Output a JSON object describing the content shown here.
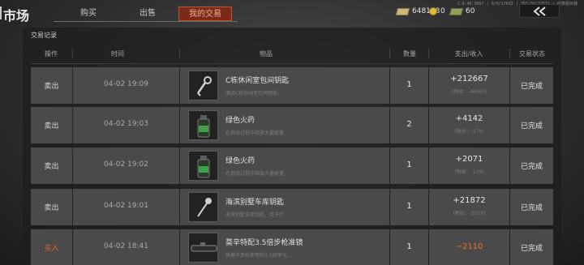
{
  "header": {
    "title": "市场",
    "tabs": [
      {
        "label": "购买",
        "active": false
      },
      {
        "label": "出售",
        "active": false
      },
      {
        "label": "我的交易",
        "active": true
      }
    ],
    "corner_text": "1.0.46.9057 | 0/0/27632 | 355/38/33572 | 结算服务器",
    "currencies": [
      {
        "icon": "cash-icon",
        "value": "648138"
      },
      {
        "icon": "coin-icon",
        "value": "0"
      },
      {
        "icon": "bill-icon",
        "value": "60"
      }
    ],
    "back_icon": "double-chevron-left-icon"
  },
  "section_title": "交易记录",
  "columns": {
    "op": "操作",
    "time": "时间",
    "item": "物品",
    "qty": "数量",
    "amount": "支出/收入",
    "status": "交易状态"
  },
  "rows": [
    {
      "op": "卖出",
      "op_type": "sell",
      "time": "04-02 19:09",
      "icon": "key-icon",
      "name": "C栋休闲室包间钥匙",
      "desc": "酒店C栋休闲室包间钥匙。...",
      "qty": "1",
      "amount": "+212667",
      "fee": "(税收：-46063)",
      "status": "已完成"
    },
    {
      "op": "卖出",
      "op_type": "sell",
      "time": "04-02 19:03",
      "icon": "powder-bottle-icon",
      "name": "绿色火药",
      "desc": "在燃烧过程中释放大量能量...",
      "qty": "2",
      "amount": "+4142",
      "fee": "(税收：-278)",
      "status": "已完成"
    },
    {
      "op": "卖出",
      "op_type": "sell",
      "time": "04-02 19:02",
      "icon": "powder-bottle-icon",
      "name": "绿色火药",
      "desc": "在燃烧过程中释放大量能量...",
      "qty": "1",
      "amount": "+2071",
      "fee": "(税收：-139)",
      "status": "已完成"
    },
    {
      "op": "卖出",
      "op_type": "sell",
      "time": "04-02 19:01",
      "icon": "key-icon",
      "name": "海滨别墅车库钥匙",
      "desc": "海滨别墅车库钥匙，用于打...",
      "qty": "1",
      "amount": "+21872",
      "fee": "(税收：-3518)",
      "status": "已完成"
    },
    {
      "op": "买入",
      "op_type": "buy",
      "time": "04-02 18:41",
      "icon": "scope-icon",
      "name": "莫辛特配3.5倍步枪准镜",
      "desc": "供莫辛步枪使用的3.5倍率光...",
      "qty": "1",
      "amount": "−2110",
      "fee": "",
      "status": "已完成"
    }
  ],
  "colors": {
    "accent": "#c0532d",
    "buy": "#e8652e",
    "cell": "#4a4a4a"
  }
}
